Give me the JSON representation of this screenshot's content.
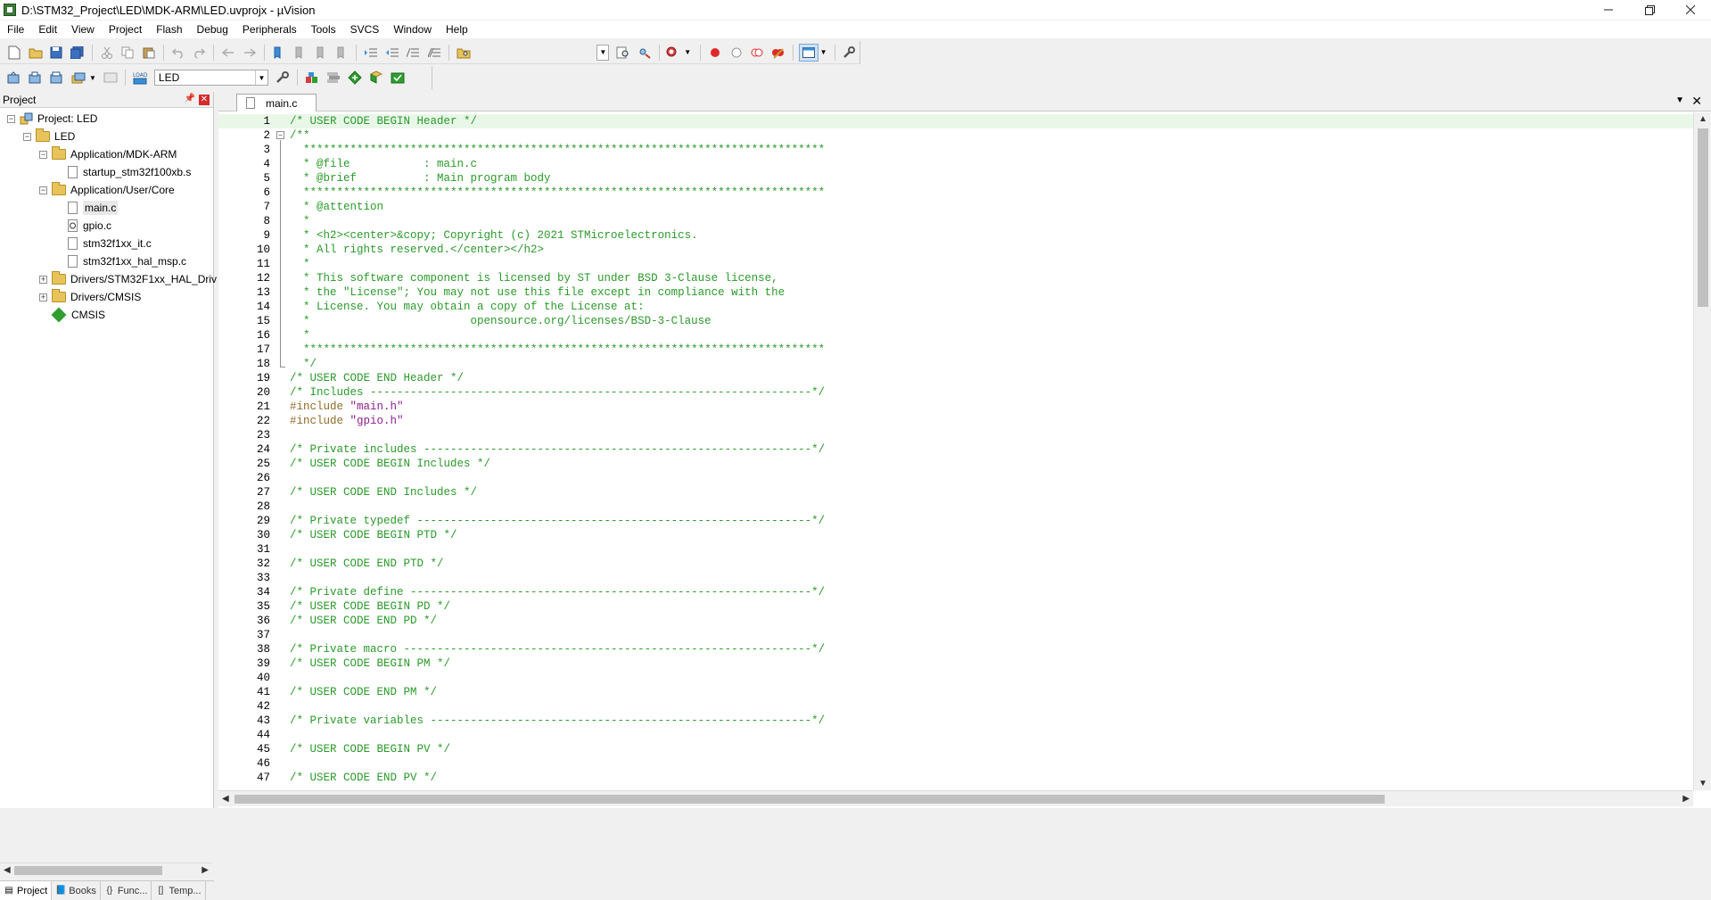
{
  "window": {
    "title": "D:\\STM32_Project\\LED\\MDK-ARM\\LED.uvprojx - µVision"
  },
  "menu": [
    "File",
    "Edit",
    "View",
    "Project",
    "Flash",
    "Debug",
    "Peripherals",
    "Tools",
    "SVCS",
    "Window",
    "Help"
  ],
  "toolbar2": {
    "target": "LED"
  },
  "project_panel": {
    "title": "Project",
    "tree": [
      {
        "label": "Project: LED",
        "level": 0,
        "type": "project",
        "expanded": true
      },
      {
        "label": "LED",
        "level": 1,
        "type": "target",
        "expanded": true
      },
      {
        "label": "Application/MDK-ARM",
        "level": 2,
        "type": "folder",
        "expanded": true
      },
      {
        "label": "startup_stm32f100xb.s",
        "level": 3,
        "type": "file"
      },
      {
        "label": "Application/User/Core",
        "level": 2,
        "type": "folder",
        "expanded": true
      },
      {
        "label": "main.c",
        "level": 3,
        "type": "file",
        "selected": true
      },
      {
        "label": "gpio.c",
        "level": 3,
        "type": "file-mod"
      },
      {
        "label": "stm32f1xx_it.c",
        "level": 3,
        "type": "file"
      },
      {
        "label": "stm32f1xx_hal_msp.c",
        "level": 3,
        "type": "file"
      },
      {
        "label": "Drivers/STM32F1xx_HAL_Driv",
        "level": 2,
        "type": "folder",
        "expanded": false
      },
      {
        "label": "Drivers/CMSIS",
        "level": 2,
        "type": "folder",
        "expanded": false
      },
      {
        "label": "CMSIS",
        "level": 2,
        "type": "cmsis"
      }
    ],
    "tabs": [
      "Project",
      "Books",
      "Func...",
      "Temp..."
    ]
  },
  "editor": {
    "tab": "main.c",
    "lines": [
      "/* USER CODE BEGIN Header */",
      "/**",
      "  ******************************************************************************",
      "  * @file           : main.c",
      "  * @brief          : Main program body",
      "  ******************************************************************************",
      "  * @attention",
      "  *",
      "  * <h2><center>&copy; Copyright (c) 2021 STMicroelectronics.",
      "  * All rights reserved.</center></h2>",
      "  *",
      "  * This software component is licensed by ST under BSD 3-Clause license,",
      "  * the \"License\"; You may not use this file except in compliance with the",
      "  * License. You may obtain a copy of the License at:",
      "  *                        opensource.org/licenses/BSD-3-Clause",
      "  *",
      "  ******************************************************************************",
      "  */",
      "/* USER CODE END Header */",
      "/* Includes ------------------------------------------------------------------*/",
      "#include \"main.h\"",
      "#include \"gpio.h\"",
      "",
      "/* Private includes ----------------------------------------------------------*/",
      "/* USER CODE BEGIN Includes */",
      "",
      "/* USER CODE END Includes */",
      "",
      "/* Private typedef -----------------------------------------------------------*/",
      "/* USER CODE BEGIN PTD */",
      "",
      "/* USER CODE END PTD */",
      "",
      "/* Private define ------------------------------------------------------------*/",
      "/* USER CODE BEGIN PD */",
      "/* USER CODE END PD */",
      "",
      "/* Private macro -------------------------------------------------------------*/",
      "/* USER CODE BEGIN PM */",
      "",
      "/* USER CODE END PM */",
      "",
      "/* Private variables ---------------------------------------------------------*/",
      "",
      "/* USER CODE BEGIN PV */",
      "",
      "/* USER CODE END PV */"
    ]
  },
  "colors": {
    "comment": "#2a9a2a",
    "preprocessor": "#8f6b2a",
    "string": "#8b1e8b",
    "current_line": "#e8f7e8"
  }
}
